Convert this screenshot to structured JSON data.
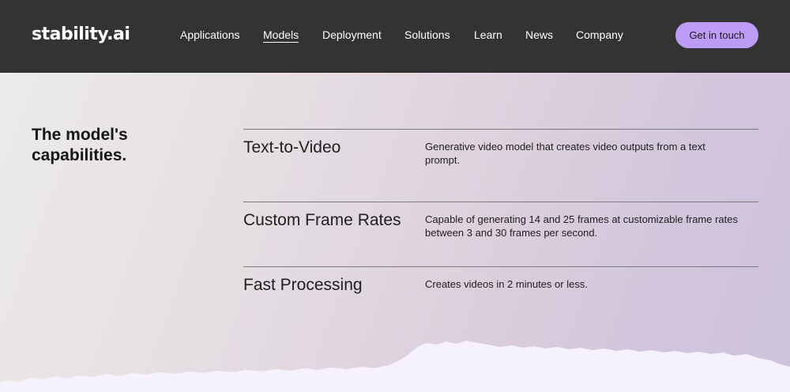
{
  "header": {
    "logo": "stability.ai",
    "nav": [
      {
        "label": "Applications",
        "active": false
      },
      {
        "label": "Models",
        "active": true
      },
      {
        "label": "Deployment",
        "active": false
      },
      {
        "label": "Solutions",
        "active": false
      },
      {
        "label": "Learn",
        "active": false
      },
      {
        "label": "News",
        "active": false
      },
      {
        "label": "Company",
        "active": false
      }
    ],
    "cta_label": "Get in touch"
  },
  "capabilities": {
    "title": "The model's capabilities.",
    "items": [
      {
        "name": "Text-to-Video",
        "description": "Generative video model that creates video outputs from a text prompt."
      },
      {
        "name": "Custom Frame Rates",
        "description": "Capable of generating 14 and 25 frames at customizable frame rates between 3 and 30 frames per second."
      },
      {
        "name": "Fast Processing",
        "description": "Creates videos in 2 minutes or less."
      }
    ]
  },
  "colors": {
    "header_bg": "#333333",
    "accent": "#bd9cf7",
    "footer_bg": "#f6f2fd"
  }
}
